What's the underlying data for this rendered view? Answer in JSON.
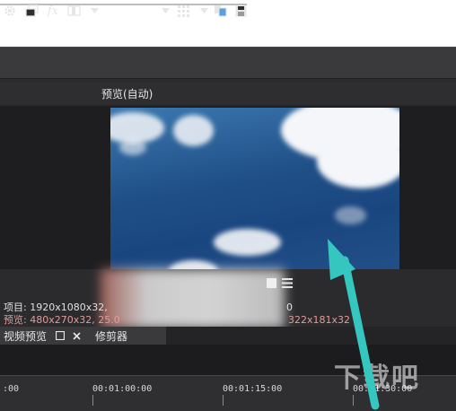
{
  "toolbar": {
    "icons": [
      "gear-icon",
      "layers-icon",
      "fx-icon",
      "split-view-icon",
      "chevron-down-icon",
      "grid-icon",
      "chevron-down-icon",
      "copy-icon",
      "save-icon"
    ],
    "fx_label": "fx",
    "preview_label": "预览(自动)"
  },
  "overlay": {
    "menu_icon": "hamburger-icon",
    "value_top": "0",
    "value_bottom": "322x181x32"
  },
  "status": {
    "project": "项目: 1920x1080x32,",
    "preview": "预览: 480x270x32, 25.0"
  },
  "tabs": {
    "video_preview": "视频预览",
    "trimmer": "修剪器"
  },
  "timeline": {
    "ticks": [
      ":00",
      "00:01:00:00",
      "00:01:15:00",
      "00:01:30:00"
    ]
  },
  "watermark": "下载吧",
  "colors": {
    "accent_arrow": "#35c6c0",
    "preview_text": "#e39a9a"
  }
}
